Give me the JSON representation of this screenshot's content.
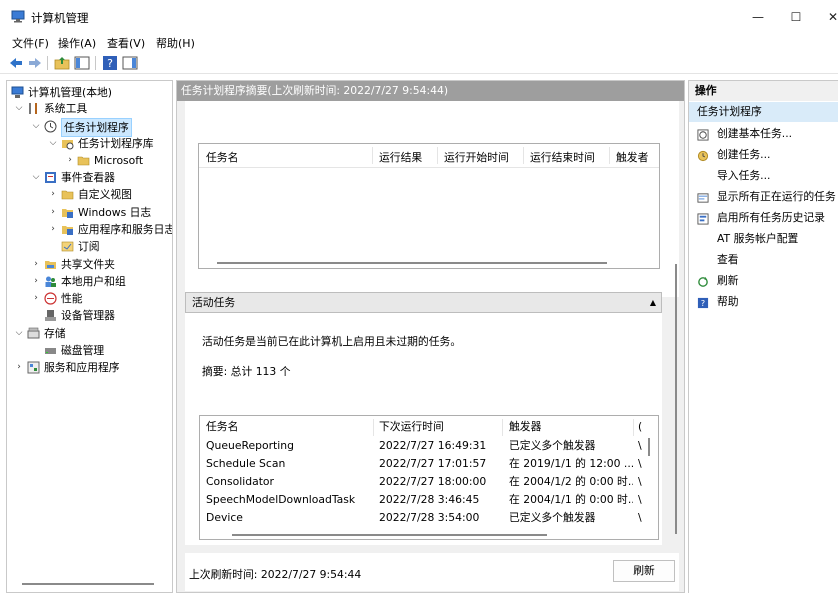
{
  "window": {
    "title": "计算机管理",
    "min_glyph": "—",
    "max_glyph": "☐",
    "close_glyph": "✕"
  },
  "menu": [
    "文件(F)",
    "操作(A)",
    "查看(V)",
    "帮助(H)"
  ],
  "tree": [
    {
      "label": "计算机管理(本地)",
      "icon": "computer-management-icon",
      "chevron": ""
    },
    {
      "label": "系统工具",
      "icon": "tools-icon",
      "chevron": "⌵"
    },
    {
      "label": "任务计划程序",
      "icon": "clock-icon",
      "chevron": "⌵"
    },
    {
      "label": "任务计划程序库",
      "icon": "folder-clock-icon",
      "chevron": "⌵"
    },
    {
      "label": "Microsoft",
      "icon": "folder-icon",
      "chevron": "›"
    },
    {
      "label": "事件查看器",
      "icon": "event-viewer-icon",
      "chevron": "⌵"
    },
    {
      "label": "自定义视图",
      "icon": "folder-icon",
      "chevron": "›"
    },
    {
      "label": "Windows 日志",
      "icon": "log-folder-icon",
      "chevron": "›"
    },
    {
      "label": "应用程序和服务日志",
      "icon": "log-folder-icon",
      "chevron": "›"
    },
    {
      "label": "订阅",
      "icon": "subscription-icon",
      "chevron": ""
    },
    {
      "label": "共享文件夹",
      "icon": "shared-folder-icon",
      "chevron": "›"
    },
    {
      "label": "本地用户和组",
      "icon": "users-icon",
      "chevron": "›"
    },
    {
      "label": "性能",
      "icon": "performance-icon",
      "chevron": "›"
    },
    {
      "label": "设备管理器",
      "icon": "device-manager-icon",
      "chevron": ""
    },
    {
      "label": "存储",
      "icon": "storage-icon",
      "chevron": "⌵"
    },
    {
      "label": "磁盘管理",
      "icon": "disk-icon",
      "chevron": ""
    },
    {
      "label": "服务和应用程序",
      "icon": "services-icon",
      "chevron": "›"
    }
  ],
  "center": {
    "header": "任务计划程序摘要(上次刷新时间: 2022/7/27 9:54:44)",
    "upper_columns": [
      "任务名",
      "运行结果",
      "运行开始时间",
      "运行结束时间",
      "触发者"
    ],
    "section_title": "活动任务",
    "section_arrow": "▲",
    "description": "活动任务是当前已在此计算机上启用且未过期的任务。",
    "summary": "摘要: 总计 113 个",
    "active_columns": [
      "任务名",
      "下次运行时间",
      "触发器",
      "("
    ],
    "active_rows": [
      [
        "QueueReporting",
        "2022/7/27 16:49:31",
        "已定义多个触发器",
        "\\"
      ],
      [
        "Schedule Scan",
        "2022/7/27 17:01:57",
        "在 2019/1/1 的 12:00 ...",
        "\\"
      ],
      [
        "Consolidator",
        "2022/7/27 18:00:00",
        "在 2004/1/2 的 0:00 时...",
        "\\"
      ],
      [
        "SpeechModelDownloadTask",
        "2022/7/28 3:46:45",
        "在 2004/1/1 的 0:00 时...",
        "\\"
      ],
      [
        "Device",
        "2022/7/28 3:54:00",
        "已定义多个触发器",
        "\\"
      ]
    ],
    "status": "上次刷新时间: 2022/7/27 9:54:44",
    "refresh_label": "刷新"
  },
  "actions": {
    "header": "操作",
    "subheader": "任务计划程序",
    "items": [
      {
        "label": "创建基本任务...",
        "icon": "create-basic-task-icon"
      },
      {
        "label": "创建任务...",
        "icon": "create-task-icon"
      },
      {
        "label": "导入任务...",
        "icon": ""
      },
      {
        "label": "显示所有正在运行的任务",
        "icon": "running-tasks-icon"
      },
      {
        "label": "启用所有任务历史记录",
        "icon": "history-icon"
      },
      {
        "label": "AT 服务帐户配置",
        "icon": ""
      },
      {
        "label": "查看",
        "icon": ""
      },
      {
        "label": "刷新",
        "icon": "refresh-icon"
      },
      {
        "label": "帮助",
        "icon": "help-icon"
      }
    ]
  },
  "colors": {
    "selection": "#cce8ff",
    "header_gray": "#9e9e9e",
    "action_highlight": "#d9ebf9"
  }
}
